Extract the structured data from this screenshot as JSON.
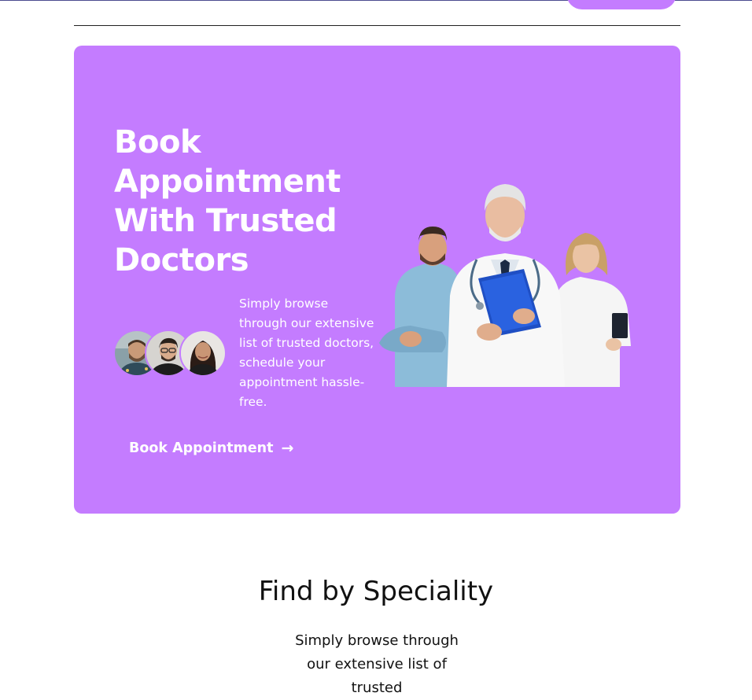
{
  "hero": {
    "title": "Book Appointment With Trusted Doctors",
    "description": "Simply browse through our extensive list of trusted doctors, schedule your appointment hassle-free.",
    "button_label": "Book Appointment",
    "button_icon": "arrow-right-icon",
    "background_color": "#c47cff",
    "avatar_count": 3
  },
  "speciality": {
    "title": "Find by Speciality",
    "description": "Simply browse through our extensive list of trusted"
  }
}
